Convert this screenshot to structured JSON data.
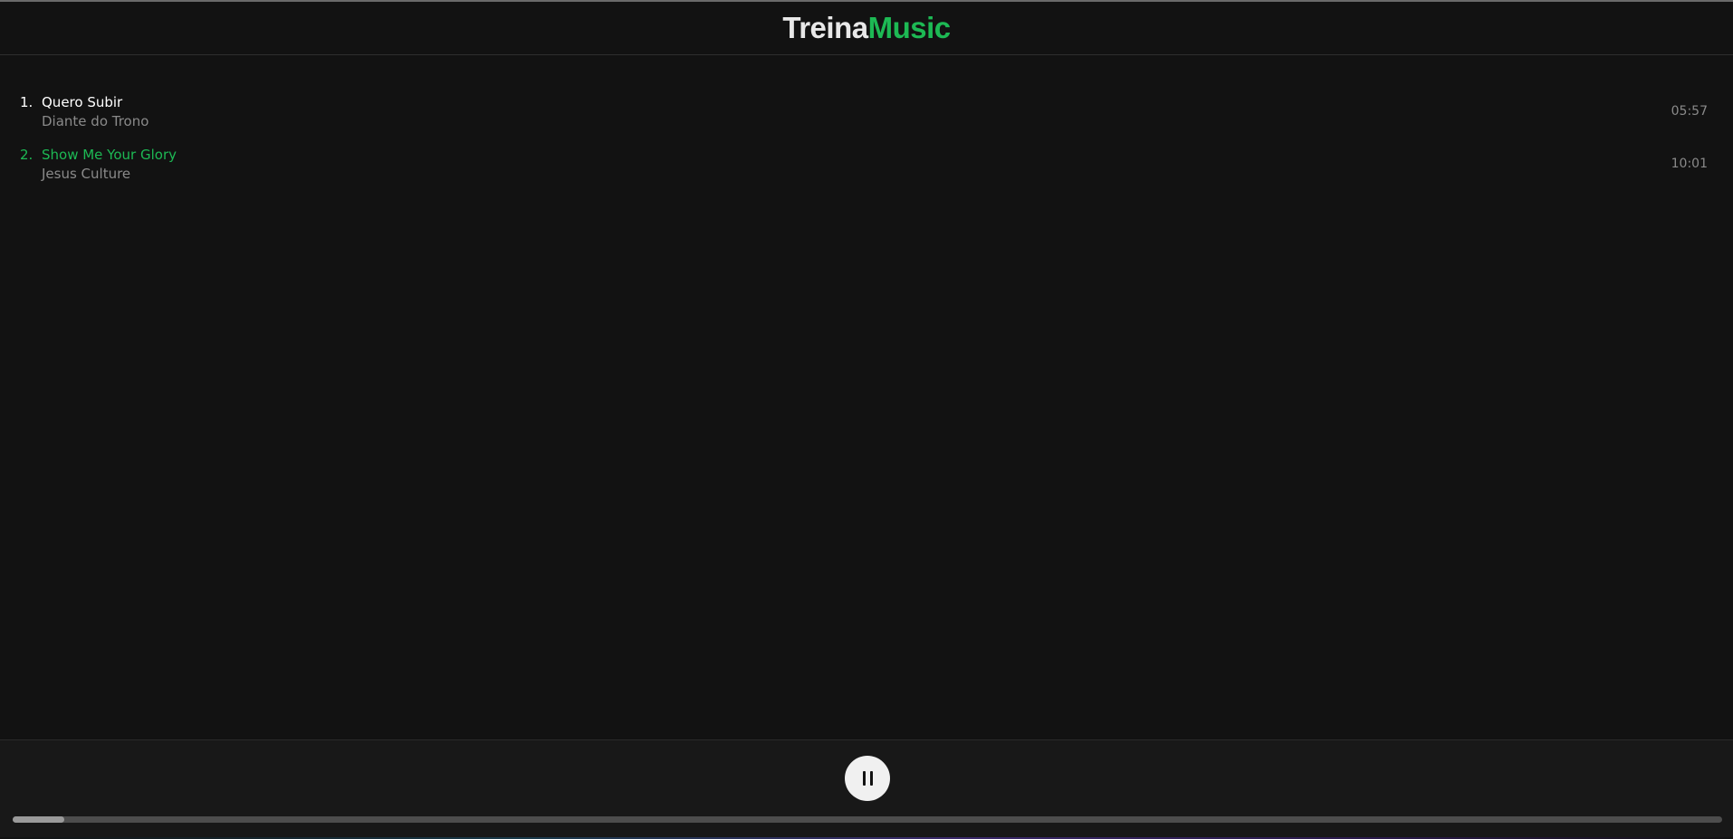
{
  "app": {
    "logo_part1": "Treina",
    "logo_part2": "Music",
    "accent_color": "#1db954"
  },
  "tracks": [
    {
      "number": "1.",
      "title": "Quero Subir",
      "artist": "Diante do Trono",
      "duration": "05:57",
      "active": false
    },
    {
      "number": "2.",
      "title": "Show Me Your Glory",
      "artist": "Jesus Culture",
      "duration": "10:01",
      "active": true
    }
  ],
  "player": {
    "state": "playing",
    "button_icon": "pause-icon",
    "progress_percent": 3
  }
}
